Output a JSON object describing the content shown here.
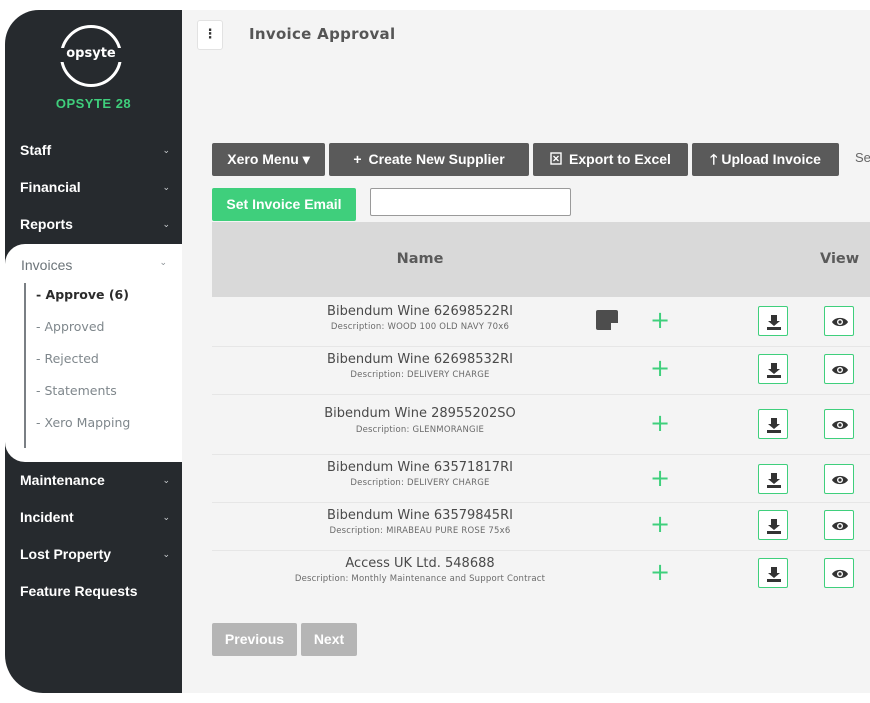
{
  "sidebar": {
    "logo_text": "opsyte",
    "brand": "OPSYTE 28",
    "items": [
      {
        "label": "Staff"
      },
      {
        "label": "Financial"
      },
      {
        "label": "Reports"
      }
    ],
    "invoices": {
      "label": "Invoices",
      "sub": [
        {
          "label": "- Approve (6)"
        },
        {
          "label": "- Approved"
        },
        {
          "label": "- Rejected"
        },
        {
          "label": "- Statements"
        },
        {
          "label": "- Xero Mapping"
        }
      ]
    },
    "items_after": [
      {
        "label": "Maintenance"
      },
      {
        "label": "Incident"
      },
      {
        "label": "Lost Property"
      },
      {
        "label": "Feature Requests"
      }
    ]
  },
  "header": {
    "title": "Invoice Approval"
  },
  "toolbar": {
    "xero_menu": "Xero Menu ▾",
    "create_supplier": "Create New Supplier",
    "export_excel": "Export to Excel",
    "upload_invoice": "Upload Invoice",
    "truncated": "Se",
    "set_invoice_email": "Set Invoice Email",
    "email_value": ""
  },
  "table": {
    "headers": {
      "name": "Name",
      "view": "View"
    },
    "rows": [
      {
        "name": "Bibendum Wine 62698522RI",
        "description": "Description: WOOD 100 OLD NAVY 70x6",
        "has_note": true
      },
      {
        "name": "Bibendum Wine 62698532RI",
        "description": "Description: DELIVERY CHARGE",
        "has_note": false
      },
      {
        "name": "Bibendum Wine 28955202SO",
        "description": "Description: GLENMORANGIE",
        "has_note": false
      },
      {
        "name": "Bibendum Wine 63571817RI",
        "description": "Description: DELIVERY CHARGE",
        "has_note": false
      },
      {
        "name": "Bibendum Wine 63579845RI",
        "description": "Description: MIRABEAU PURE ROSE 75x6",
        "has_note": false
      },
      {
        "name": "Access UK Ltd. 548688",
        "description": "Description: Monthly Maintenance and Support Contract",
        "has_note": false
      }
    ]
  },
  "pagination": {
    "previous": "Previous",
    "next": "Next"
  },
  "colors": {
    "sidebar": "#262a2e",
    "accent_green": "#3fcf7c",
    "button_dark": "#5a5a5a"
  }
}
